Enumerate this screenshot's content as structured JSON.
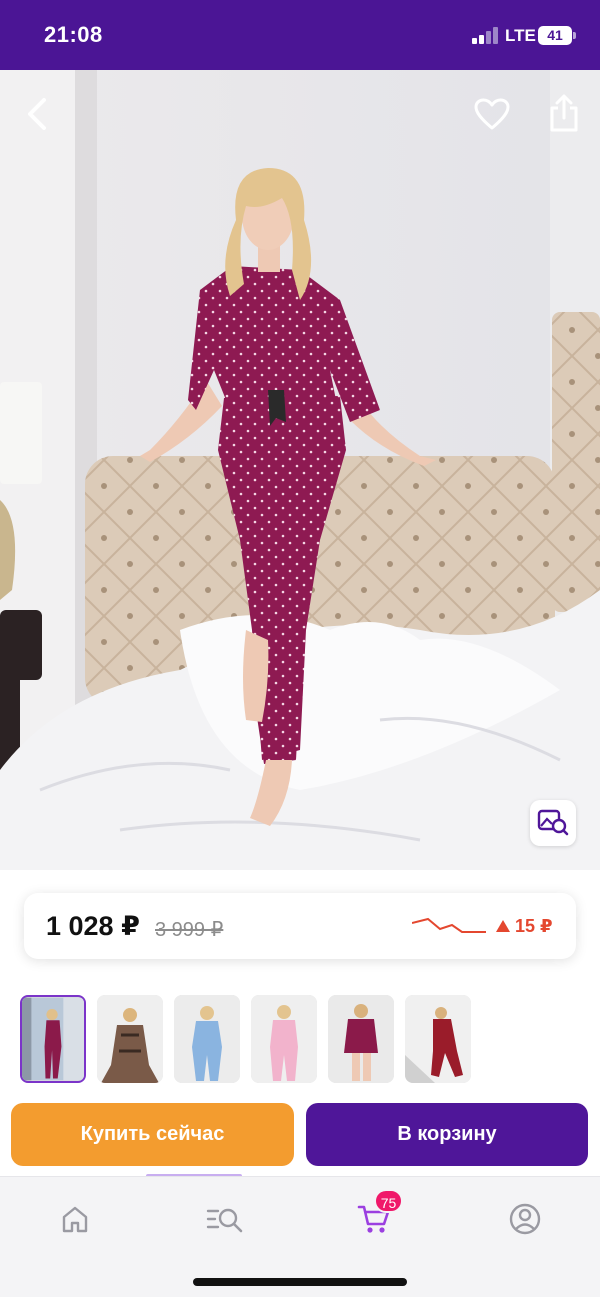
{
  "status_bar": {
    "time": "21:08",
    "network": "LTE",
    "battery": "41"
  },
  "hero": {
    "icons": [
      "back-icon",
      "heart-icon",
      "share-icon",
      "image-search-icon"
    ]
  },
  "price": {
    "current": "1 028 ₽",
    "old": "3 999 ₽",
    "change": "15 ₽",
    "change_direction": "up",
    "trend_color": "#e4472f"
  },
  "thumbnails": [
    {
      "selected": true,
      "outfit_color": "#8b1a4a"
    },
    {
      "selected": false,
      "outfit_color": "#7a5a48"
    },
    {
      "selected": false,
      "outfit_color": "#8ab4e0"
    },
    {
      "selected": false,
      "outfit_color": "#f2b3cc"
    },
    {
      "selected": false,
      "outfit_color": "#8b1a4a"
    },
    {
      "selected": false,
      "outfit_color": "#9a1c2a"
    }
  ],
  "actions": {
    "buy_now": "Купить сейчас",
    "add_to_cart": "В корзину"
  },
  "tab_bar": {
    "tabs": [
      "home-icon",
      "catalog-search-icon",
      "cart-icon",
      "profile-icon"
    ],
    "cart_count": "75"
  },
  "colors": {
    "brand": "#4b1595",
    "buy_now": "#f39c2f",
    "add_to_cart": "#4f1699",
    "badge": "#f0186a"
  }
}
